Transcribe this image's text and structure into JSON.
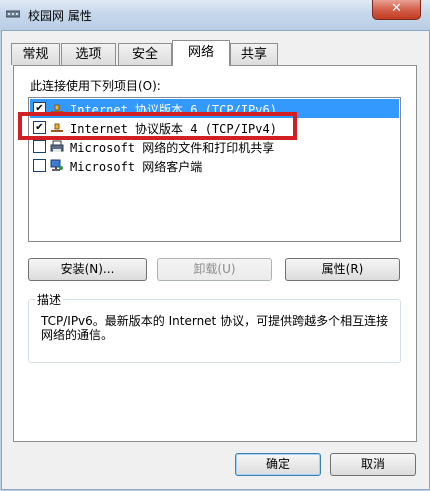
{
  "window": {
    "title": "校园网 属性",
    "close_glyph": "✕"
  },
  "tabs": [
    {
      "label": "常规"
    },
    {
      "label": "选项"
    },
    {
      "label": "安全"
    },
    {
      "label": "网络"
    },
    {
      "label": "共享"
    }
  ],
  "active_tab": "网络",
  "network": {
    "connection_label": "此连接使用下列项目(O):",
    "items": [
      {
        "label": "Internet 协议版本 6 (TCP/IPv6)",
        "checked": true,
        "selected": true,
        "icon": "network-protocol-icon"
      },
      {
        "label": "Internet 协议版本 4 (TCP/IPv4)",
        "checked": true,
        "selected": false,
        "icon": "network-protocol-icon"
      },
      {
        "label": "Microsoft 网络的文件和打印机共享",
        "checked": false,
        "selected": false,
        "icon": "printer-share-icon"
      },
      {
        "label": "Microsoft 网络客户端",
        "checked": false,
        "selected": false,
        "icon": "network-client-icon"
      }
    ],
    "check_glyph": "✔",
    "buttons": {
      "install": "安装(N)...",
      "uninstall": "卸载(U)",
      "properties": "属性(R)"
    },
    "description": {
      "title": "描述",
      "text": "TCP/IPv6。最新版本的 Internet 协议，可提供跨越多个相互连接网络的通信。"
    }
  },
  "footer": {
    "ok": "确定",
    "cancel": "取消"
  },
  "colors": {
    "selection": "#3399ff",
    "highlight_box": "#d11f24"
  }
}
